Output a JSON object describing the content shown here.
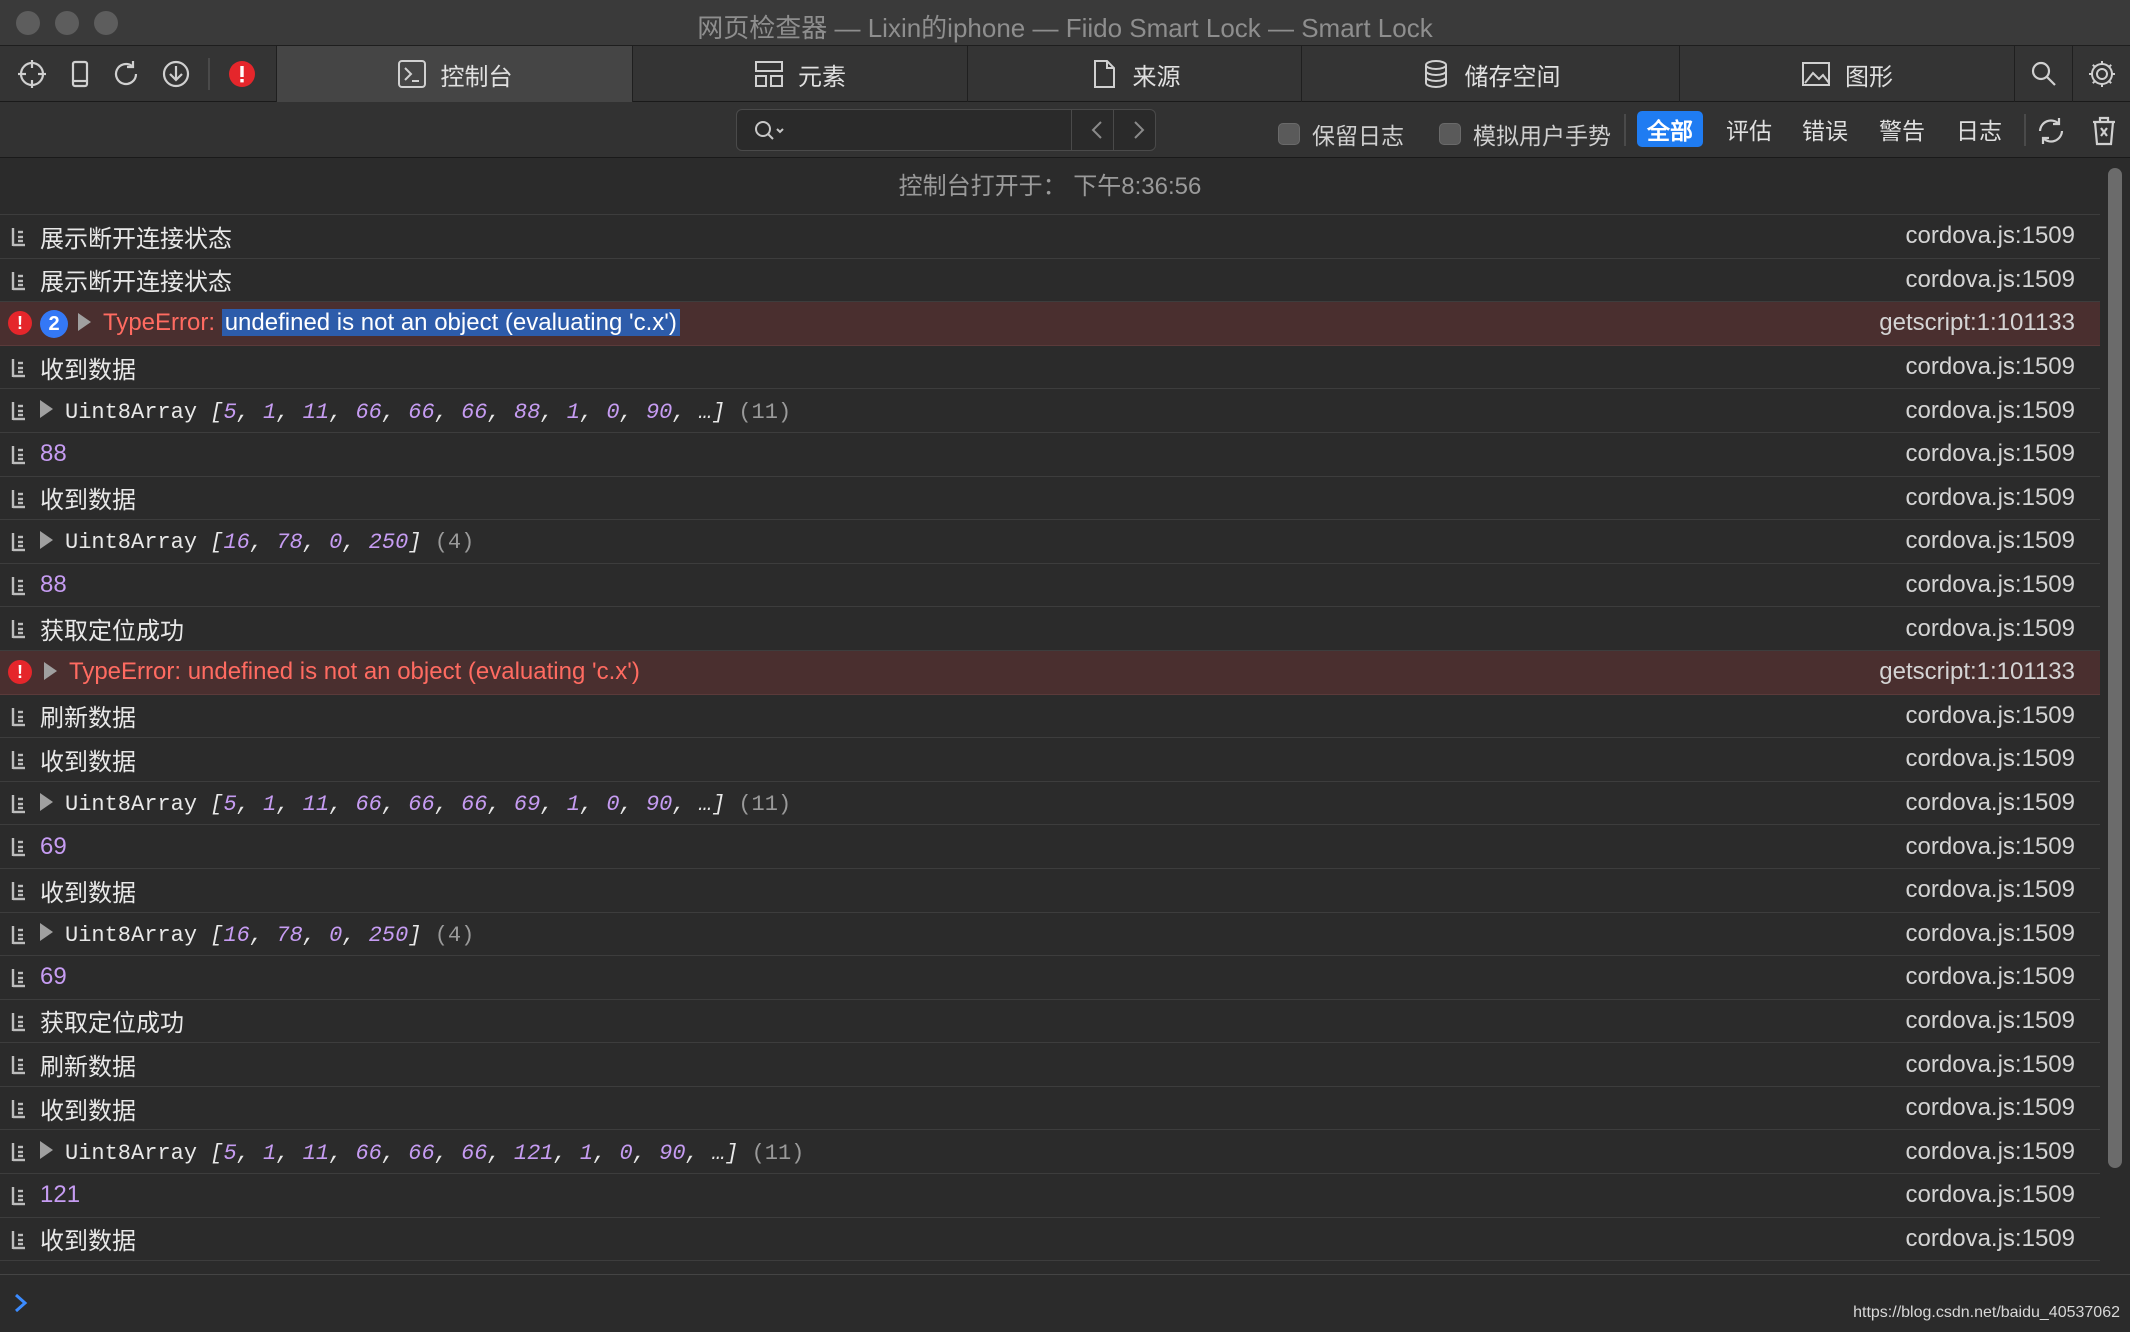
{
  "window": {
    "title": "网页检查器 — Lixin的iphone — Fiido Smart Lock — Smart Lock"
  },
  "tabs": [
    {
      "label": "控制台",
      "icon": "console-icon"
    },
    {
      "label": "元素",
      "icon": "elements-icon"
    },
    {
      "label": "来源",
      "icon": "document-icon"
    },
    {
      "label": "储存空间",
      "icon": "database-icon"
    },
    {
      "label": "图形",
      "icon": "image-icon"
    }
  ],
  "filter": {
    "search_placeholder": "",
    "preserve_log": "保留日志",
    "emulate_gesture": "模拟用户手势",
    "levels": [
      "全部",
      "评估",
      "错误",
      "警告",
      "日志"
    ],
    "active_level": "全部"
  },
  "console": {
    "session_text": "控制台打开于：  下午8:36:56",
    "rows": [
      {
        "type": "log",
        "text": "展示断开连接状态",
        "source": "cordova.js:1509"
      },
      {
        "type": "log",
        "text": "展示断开连接状态",
        "source": "cordova.js:1509"
      },
      {
        "type": "error",
        "badge": "2",
        "prefix": "TypeError: ",
        "text": "undefined is not an object (evaluating 'c.x')",
        "source": "getscript:1:101133"
      },
      {
        "type": "log",
        "text": "收到数据",
        "source": "cordova.js:1509"
      },
      {
        "type": "array",
        "name": "Uint8Array",
        "items": [
          "5",
          "1",
          "11",
          "66",
          "66",
          "66",
          "88",
          "1",
          "0",
          "90",
          "…"
        ],
        "count": "(11)",
        "source": "cordova.js:1509"
      },
      {
        "type": "number",
        "text": "88",
        "source": "cordova.js:1509"
      },
      {
        "type": "log",
        "text": "收到数据",
        "source": "cordova.js:1509"
      },
      {
        "type": "array",
        "name": "Uint8Array",
        "items": [
          "16",
          "78",
          "0",
          "250"
        ],
        "count": "(4)",
        "source": "cordova.js:1509"
      },
      {
        "type": "number",
        "text": "88",
        "source": "cordova.js:1509"
      },
      {
        "type": "log",
        "text": "获取定位成功",
        "source": "cordova.js:1509"
      },
      {
        "type": "error",
        "prefix": "TypeError: ",
        "text": "undefined is not an object (evaluating 'c.x')",
        "source": "getscript:1:101133"
      },
      {
        "type": "log",
        "text": "刷新数据",
        "source": "cordova.js:1509"
      },
      {
        "type": "log",
        "text": "收到数据",
        "source": "cordova.js:1509"
      },
      {
        "type": "array",
        "name": "Uint8Array",
        "items": [
          "5",
          "1",
          "11",
          "66",
          "66",
          "66",
          "69",
          "1",
          "0",
          "90",
          "…"
        ],
        "count": "(11)",
        "source": "cordova.js:1509"
      },
      {
        "type": "number",
        "text": "69",
        "source": "cordova.js:1509"
      },
      {
        "type": "log",
        "text": "收到数据",
        "source": "cordova.js:1509"
      },
      {
        "type": "array",
        "name": "Uint8Array",
        "items": [
          "16",
          "78",
          "0",
          "250"
        ],
        "count": "(4)",
        "source": "cordova.js:1509"
      },
      {
        "type": "number",
        "text": "69",
        "source": "cordova.js:1509"
      },
      {
        "type": "log",
        "text": "获取定位成功",
        "source": "cordova.js:1509"
      },
      {
        "type": "log",
        "text": "刷新数据",
        "source": "cordova.js:1509"
      },
      {
        "type": "log",
        "text": "收到数据",
        "source": "cordova.js:1509"
      },
      {
        "type": "array",
        "name": "Uint8Array",
        "items": [
          "5",
          "1",
          "11",
          "66",
          "66",
          "66",
          "121",
          "1",
          "0",
          "90",
          "…"
        ],
        "count": "(11)",
        "source": "cordova.js:1509"
      },
      {
        "type": "number",
        "text": "121",
        "source": "cordova.js:1509"
      },
      {
        "type": "log",
        "text": "收到数据",
        "source": "cordova.js:1509"
      }
    ]
  },
  "watermark": "https://blog.csdn.net/baidu_40537062",
  "colors": {
    "accent": "#1f7cf2",
    "error": "#ff6b61",
    "number": "#c69cf2",
    "error_row": "#4a2f2f"
  }
}
